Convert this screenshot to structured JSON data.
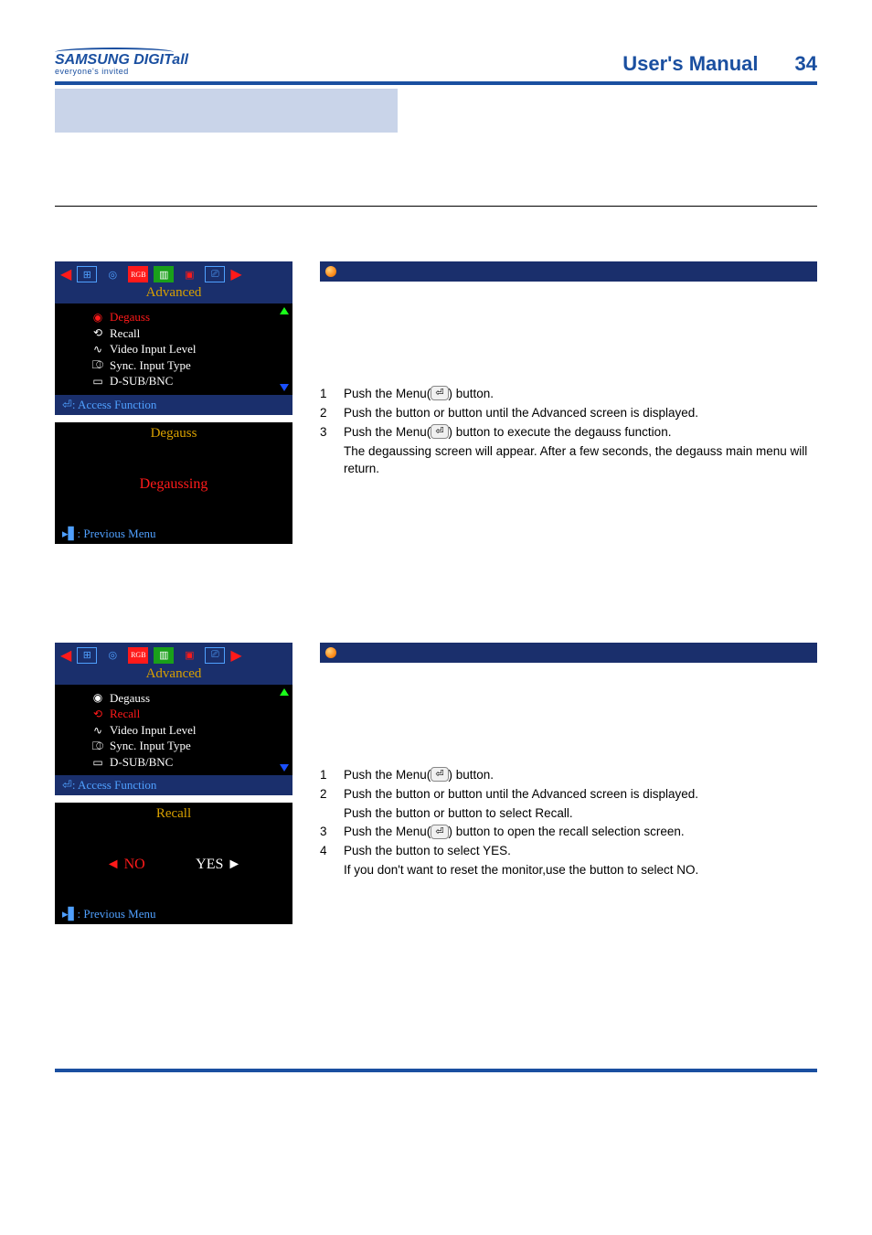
{
  "header": {
    "brand_main": "SAMSUNG DIGIT",
    "brand_suffix": "all",
    "brand_tag": "everyone's invited",
    "title": "User's Manual",
    "page_number": "34"
  },
  "osd": {
    "menu_title": "Advanced",
    "items": [
      "Degauss",
      "Recall",
      "Video Input Level",
      "Sync. Input Type",
      "D-SUB/BNC"
    ],
    "access_label": ": Access Function",
    "prev_label": ": Previous Menu"
  },
  "section1": {
    "highlight_index": 0,
    "sub_title": "Degauss",
    "sub_body": "Degaussing",
    "steps": [
      {
        "n": "1",
        "t": "Push the Menu(      ) button."
      },
      {
        "n": "2",
        "t": "Push the    button or    button until the Advanced screen is displayed."
      },
      {
        "n": "3",
        "t": "Push the Menu(      ) button to execute the degauss function."
      },
      {
        "n": "",
        "t": "The degaussing screen will appear. After a few seconds, the degauss main menu will return."
      }
    ]
  },
  "section2": {
    "highlight_index": 1,
    "sub_title": "Recall",
    "no_label": "◄ NO",
    "yes_label": "YES ►",
    "steps": [
      {
        "n": "1",
        "t": "Push the Menu(      ) button."
      },
      {
        "n": "2",
        "t": "Push the    button or    button until the Advanced screen is displayed."
      },
      {
        "n": "",
        "t": "Push the    button or    button to select Recall."
      },
      {
        "n": "3",
        "t": "Push the Menu(      ) button to open the recall selection screen."
      },
      {
        "n": "4",
        "t": "Push the    button to select YES."
      },
      {
        "n": "",
        "t": "If you don't want to reset the monitor,use the    button to select NO."
      }
    ]
  }
}
